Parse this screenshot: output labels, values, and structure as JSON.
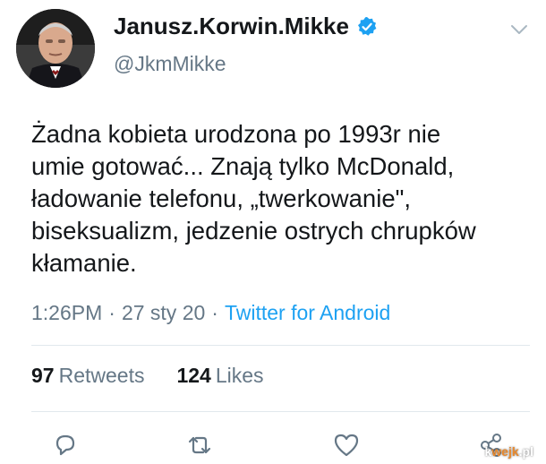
{
  "tweet": {
    "display_name": "Janusz.Korwin.Mikke",
    "handle": "@JkmMikke",
    "text_lines": [
      "Żadna kobieta urodzona po 1993r nie",
      "umie gotować... Znają tylko McDonald,",
      "ładowanie telefonu, „twerkowanie\",",
      "biseksualizm, jedzenie ostrych chrupków",
      "kłamanie."
    ],
    "time": "1:26PM",
    "date": "27 sty 20",
    "source": "Twitter for Android",
    "separator": "·",
    "retweets_count": "97",
    "retweets_label": "Retweets",
    "likes_count": "124",
    "likes_label": "Likes"
  },
  "icons": {
    "verified": "verified-badge-icon",
    "menu": "chevron-down-icon",
    "reply": "reply-icon",
    "retweet": "retweet-icon",
    "like": "heart-icon",
    "share": "share-icon"
  },
  "watermark": {
    "prefix": "k",
    "accent": "wejk",
    "suffix": ".pl"
  },
  "colors": {
    "text": "#14171a",
    "secondary": "#657786",
    "link": "#1da1f2",
    "divider": "#e1e8ed"
  }
}
